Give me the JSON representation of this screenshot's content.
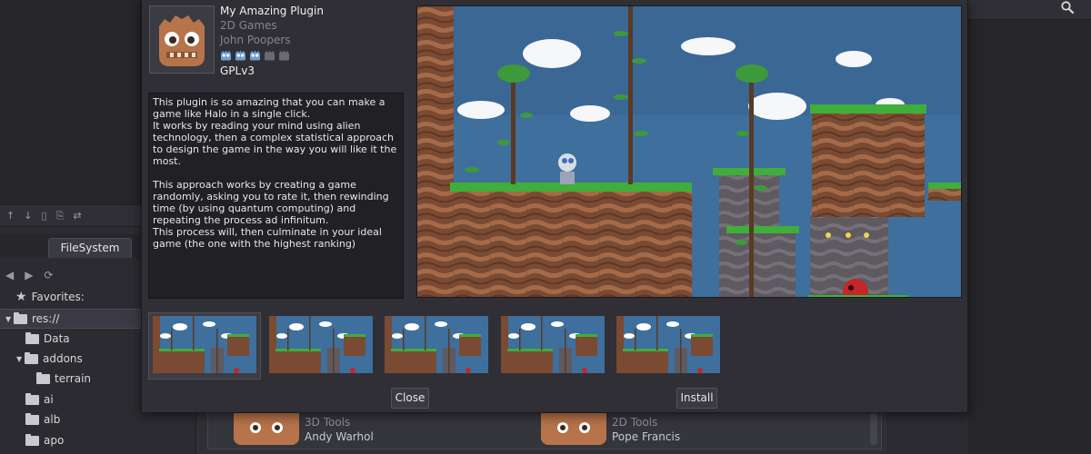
{
  "dialog": {
    "plugin": {
      "title": "My Amazing Plugin",
      "category": "2D Games",
      "author": "John Poopers",
      "rating": 3,
      "rating_max": 5,
      "license": "GPLv3",
      "icon": "godot-logo-icon"
    },
    "description": [
      "This plugin is so amazing that you can make a game like Halo in a single click.\nIt works by reading your mind using alien technology, then a complex statistical approach to design the game in the way you will like it the most.",
      "This approach works by creating a game randomly, asking you to rate it, then rewinding time (by using quantum computing) and repeating the process ad infinitum.\nThis process will, then culminate in your ideal game (the one with the highest ranking)"
    ],
    "thumbnails_count": 5,
    "selected_thumbnail": 0,
    "buttons": {
      "close": "Close",
      "install": "Install"
    }
  },
  "filesystem": {
    "tab_label": "FileSystem",
    "favorites_label": "Favorites:",
    "tree": [
      {
        "label": "res://",
        "expanded": true,
        "selected": true
      },
      {
        "label": "Data"
      },
      {
        "label": "addons",
        "expanded": true
      },
      {
        "label": "terrain"
      },
      {
        "label": "ai"
      },
      {
        "label": "alb"
      },
      {
        "label": "apo"
      }
    ]
  },
  "assets": [
    {
      "category": "3D Tools",
      "author": "Andy Warhol"
    },
    {
      "category": "2D Tools",
      "author": "Pope Francis"
    }
  ],
  "colors": {
    "accent_icon": "#6f9fd0",
    "rating_off": "#6a6a72",
    "godot_orange": "#b7744a"
  }
}
